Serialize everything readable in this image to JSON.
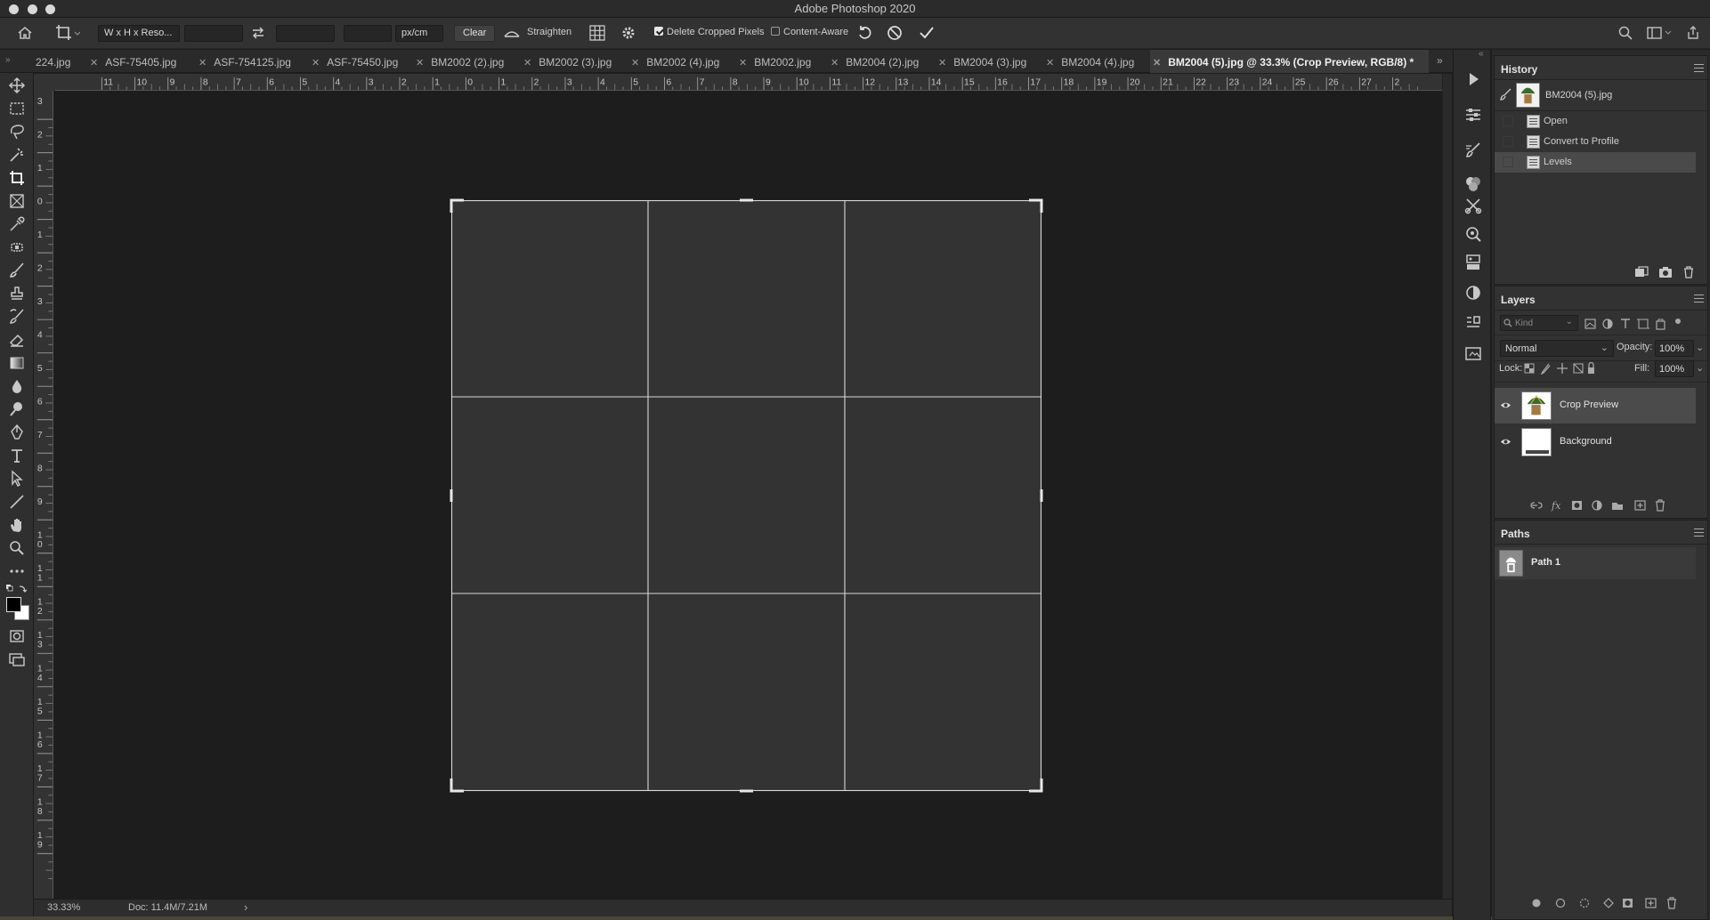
{
  "app": {
    "window_title": "Adobe Photoshop 2020"
  },
  "options_bar": {
    "ratio_dropdown": "W x H x Reso...",
    "units_dropdown": "px/cm",
    "clear_label": "Clear",
    "straighten_label": "Straighten",
    "delete_cropped_label": "Delete Cropped Pixels",
    "delete_cropped_checked": true,
    "content_aware_label": "Content-Aware",
    "content_aware_checked": false
  },
  "tabs": [
    {
      "label": "224.jpg"
    },
    {
      "label": "ASF-75405.jpg"
    },
    {
      "label": "ASF-754125.jpg"
    },
    {
      "label": "ASF-75450.jpg"
    },
    {
      "label": "BM2002 (2).jpg"
    },
    {
      "label": "BM2002 (3).jpg"
    },
    {
      "label": "BM2002 (4).jpg"
    },
    {
      "label": "BM2002.jpg"
    },
    {
      "label": "BM2004 (2).jpg"
    },
    {
      "label": "BM2004 (3).jpg"
    },
    {
      "label": "BM2004 (4).jpg"
    },
    {
      "label": "BM2004 (5).jpg @ 33.3% (Crop Preview, RGB/8) *"
    }
  ],
  "rulers": {
    "horizontal": [
      "11",
      "10",
      "9",
      "8",
      "7",
      "6",
      "5",
      "4",
      "3",
      "2",
      "1",
      "0",
      "1",
      "2",
      "3",
      "4",
      "5",
      "6",
      "7",
      "8",
      "9",
      "10",
      "11",
      "12",
      "13",
      "14",
      "15",
      "16",
      "17",
      "18",
      "19",
      "20",
      "21",
      "22",
      "23",
      "24",
      "25",
      "26",
      "27",
      "2"
    ],
    "vertical": [
      "3",
      "2",
      "1",
      "0",
      "1",
      "2",
      "3",
      "4",
      "5",
      "6",
      "7",
      "8",
      "9",
      "10",
      "11",
      "12",
      "13",
      "14",
      "15",
      "16",
      "17",
      "18",
      "19"
    ]
  },
  "status": {
    "zoom": "33.33%",
    "doc": "Doc: 11.4M/7.21M"
  },
  "history": {
    "title": "History",
    "snapshot": "BM2004 (5).jpg",
    "steps": [
      "Open",
      "Convert to Profile",
      "Levels"
    ],
    "selected_step": "Levels"
  },
  "layers": {
    "title": "Layers",
    "filter_kind": "Kind",
    "blend_mode": "Normal",
    "opacity_label": "Opacity:",
    "opacity": "100%",
    "lock_label": "Lock:",
    "fill_label": "Fill:",
    "fill": "100%",
    "items": [
      {
        "name": "Crop Preview",
        "selected": true
      },
      {
        "name": "Background",
        "selected": false
      }
    ]
  },
  "paths": {
    "title": "Paths",
    "items": [
      {
        "name": "Path 1"
      }
    ]
  },
  "colors": {
    "crop_fill": "#333333",
    "canvas_bg": "#1d1d1d",
    "grid_line": "#d9d9d9"
  }
}
